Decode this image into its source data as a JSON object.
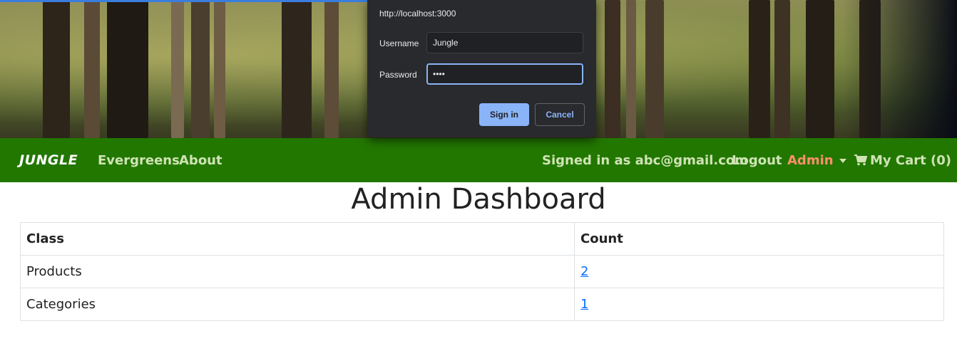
{
  "auth_dialog": {
    "url": "http://localhost:3000",
    "username_label": "Username",
    "username_value": "Jungle",
    "password_label": "Password",
    "password_masked": "••••",
    "signin_label": "Sign in",
    "cancel_label": "Cancel"
  },
  "navbar": {
    "brand": "JUNGLE",
    "links": [
      "Evergreens",
      "About"
    ],
    "signed_in": "Signed in as abc@gmail.com",
    "logout": "Logout",
    "admin": "Admin",
    "cart": "My Cart (0)",
    "bg_color": "#227700",
    "admin_color": "#ff8f6b"
  },
  "main": {
    "title": "Admin Dashboard",
    "table": {
      "headers": [
        "Class",
        "Count"
      ],
      "rows": [
        {
          "class": "Products",
          "count": "2"
        },
        {
          "class": "Categories",
          "count": "1"
        }
      ]
    }
  },
  "icons": {
    "cart": "shopping-cart-icon",
    "admin_caret": "caret-down-icon"
  }
}
